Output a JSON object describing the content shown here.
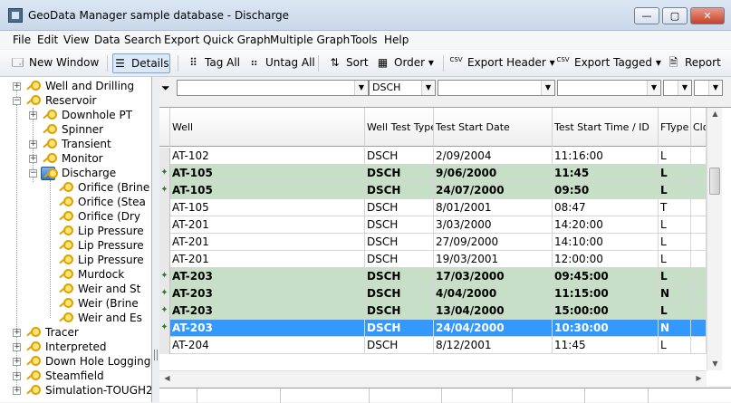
{
  "window": {
    "title": "GeoData Manager  sample database - Discharge",
    "min": "—",
    "max": "▢",
    "close": "✕"
  },
  "menu": [
    "File",
    "Edit",
    "View",
    "Data",
    "Search",
    "Export",
    "Quick Graph",
    "Multiple Graph",
    "Tools",
    "Help"
  ],
  "toolbar": {
    "new_window": "New Window",
    "details": "Details",
    "tag_all": "Tag All",
    "untag_all": "Untag All",
    "sort": "Sort",
    "order": "Order",
    "export_header": "Export Header",
    "export_tagged": "Export Tagged",
    "report": "Report",
    "csv": "CSV"
  },
  "tree": [
    {
      "label": "Well and Drilling",
      "level": 0,
      "expander": "+",
      "icon": "key"
    },
    {
      "label": "Reservoir",
      "level": 0,
      "expander": "−",
      "icon": "key"
    },
    {
      "label": "Downhole PT",
      "level": 1,
      "expander": "+",
      "icon": "key"
    },
    {
      "label": "Spinner",
      "level": 1,
      "expander": "",
      "icon": "key"
    },
    {
      "label": "Transient",
      "level": 1,
      "expander": "+",
      "icon": "key"
    },
    {
      "label": "Monitor",
      "level": 1,
      "expander": "+",
      "icon": "key"
    },
    {
      "label": "Discharge",
      "level": 1,
      "expander": "−",
      "icon": "folder"
    },
    {
      "label": "Orifice (Brine",
      "level": 2,
      "expander": "",
      "icon": "key"
    },
    {
      "label": "Orifice (Stea",
      "level": 2,
      "expander": "",
      "icon": "key"
    },
    {
      "label": "Orifice (Dry",
      "level": 2,
      "expander": "",
      "icon": "key"
    },
    {
      "label": "Lip Pressure",
      "level": 2,
      "expander": "",
      "icon": "key"
    },
    {
      "label": "Lip Pressure",
      "level": 2,
      "expander": "",
      "icon": "key"
    },
    {
      "label": "Lip Pressure",
      "level": 2,
      "expander": "",
      "icon": "key"
    },
    {
      "label": "Murdock",
      "level": 2,
      "expander": "",
      "icon": "key"
    },
    {
      "label": "Weir and St",
      "level": 2,
      "expander": "",
      "icon": "key"
    },
    {
      "label": "Weir (Brine",
      "level": 2,
      "expander": "",
      "icon": "key"
    },
    {
      "label": "Weir and Es",
      "level": 2,
      "expander": "",
      "icon": "key"
    },
    {
      "label": "Tracer",
      "level": 0,
      "expander": "+",
      "icon": "key"
    },
    {
      "label": "Interpreted",
      "level": 0,
      "expander": "+",
      "icon": "key"
    },
    {
      "label": "Down Hole Logging",
      "level": 0,
      "expander": "+",
      "icon": "key"
    },
    {
      "label": "Steamfield",
      "level": 0,
      "expander": "+",
      "icon": "key"
    },
    {
      "label": "Simulation-TOUGH2",
      "level": 0,
      "expander": "+",
      "icon": "key"
    }
  ],
  "filter": {
    "well": "",
    "test_type": "DSCH",
    "start_date": "",
    "start_time": "",
    "ftype": "",
    "close": ""
  },
  "columns": [
    "Well",
    "Well Test Type",
    "Test Start Date",
    "Test Start Time / ID",
    "FType",
    "Clo"
  ],
  "rows": [
    {
      "well": "AT-102",
      "type": "DSCH",
      "date": "2/09/2004",
      "time": "11:16:00",
      "ftype": "L",
      "state": "normal"
    },
    {
      "well": "AT-105",
      "type": "DSCH",
      "date": "9/06/2000",
      "time": "11:45",
      "ftype": "L",
      "state": "tagged"
    },
    {
      "well": "AT-105",
      "type": "DSCH",
      "date": "24/07/2000",
      "time": "09:50",
      "ftype": "L",
      "state": "tagged"
    },
    {
      "well": "AT-105",
      "type": "DSCH",
      "date": "8/01/2001",
      "time": "08:47",
      "ftype": "T",
      "state": "normal"
    },
    {
      "well": "AT-201",
      "type": "DSCH",
      "date": "3/03/2000",
      "time": "14:20:00",
      "ftype": "L",
      "state": "normal"
    },
    {
      "well": "AT-201",
      "type": "DSCH",
      "date": "27/09/2000",
      "time": "14:10:00",
      "ftype": "L",
      "state": "normal"
    },
    {
      "well": "AT-201",
      "type": "DSCH",
      "date": "19/03/2001",
      "time": "12:00:00",
      "ftype": "L",
      "state": "normal"
    },
    {
      "well": "AT-203",
      "type": "DSCH",
      "date": "17/03/2000",
      "time": "09:45:00",
      "ftype": "L",
      "state": "tagged"
    },
    {
      "well": "AT-203",
      "type": "DSCH",
      "date": "4/04/2000",
      "time": "11:15:00",
      "ftype": "N",
      "state": "tagged"
    },
    {
      "well": "AT-203",
      "type": "DSCH",
      "date": "13/04/2000",
      "time": "15:00:00",
      "ftype": "L",
      "state": "tagged"
    },
    {
      "well": "AT-203",
      "type": "DSCH",
      "date": "24/04/2000",
      "time": "10:30:00",
      "ftype": "N",
      "state": "selected"
    },
    {
      "well": "AT-204",
      "type": "DSCH",
      "date": "8/12/2001",
      "time": "11:45",
      "ftype": "L",
      "state": "normal"
    }
  ]
}
